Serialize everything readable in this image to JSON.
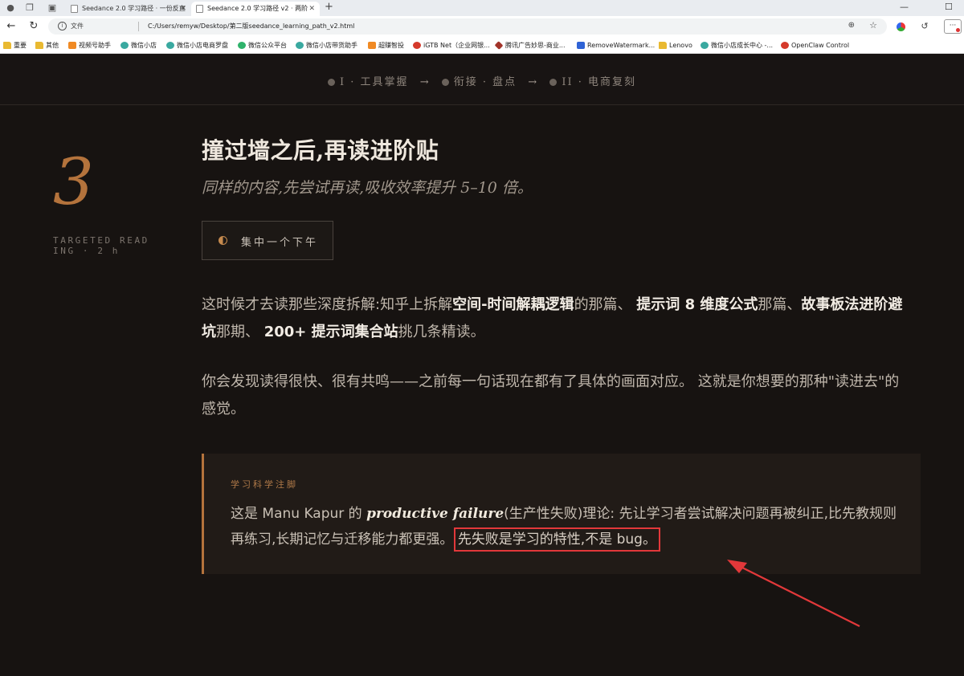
{
  "browser": {
    "tabs": [
      {
        "title": "Seedance 2.0 学习路径 · 一份反直"
      },
      {
        "title": "Seedance 2.0 学习路径 v2 · 两阶"
      }
    ],
    "address": {
      "file_label": "文件",
      "url": "C:/Users/remyw/Desktop/第二版seedance_learning_path_v2.html"
    },
    "bookmarks": [
      {
        "label": "重要",
        "icon": "folder-icon"
      },
      {
        "label": "其他",
        "icon": "folder-icon"
      },
      {
        "label": "视频号助手",
        "icon": "channels-icon"
      },
      {
        "label": "微信小店",
        "icon": "wechat-shop-icon"
      },
      {
        "label": "微信小店电商罗盘",
        "icon": "wechat-shop-icon"
      },
      {
        "label": "微信公众平台",
        "icon": "wechat-icon"
      },
      {
        "label": "微信小店带货助手",
        "icon": "wechat-shop-icon"
      },
      {
        "label": "超赚智投",
        "icon": "ad-icon"
      },
      {
        "label": "iGTB Net（企业网银...",
        "icon": "bank-icon"
      },
      {
        "label": "腾讯广告妙思-商业...",
        "icon": "tencent-ad-icon"
      },
      {
        "label": "RemoveWatermark...",
        "icon": "edit-icon"
      },
      {
        "label": "Lenovo",
        "icon": "folder-icon"
      },
      {
        "label": "微信小店成长中心 -...",
        "icon": "wechat-shop-icon"
      },
      {
        "label": "OpenClaw Control",
        "icon": "claw-icon"
      }
    ]
  },
  "progress": {
    "step1": "I · 工具掌握",
    "arrow1": "→",
    "step2": "衔接 · 盘点",
    "arrow2": "→",
    "step3": "II · 电商复刻"
  },
  "section": {
    "number": "3",
    "meta": "TARGETED READING · 2 h",
    "title": "撞过墙之后,再读进阶贴",
    "subtitle": "同样的内容,先尝试再读,吸收效率提升 5–10 倍。",
    "duration": "集中一个下午"
  },
  "para1": {
    "t1": "这时候才去读那些深度拆解:知乎上拆解",
    "b1": "空间-时间解耦逻辑",
    "t2": "的那篇、 ",
    "b2": "提示词 8 维度公式",
    "t3": "那篇、",
    "b3": "故事板法进阶避坑",
    "t4": "那期、 ",
    "b4": "200+ 提示词集合站",
    "t5": "挑几条精读。"
  },
  "para2": {
    "text": "你会发现读得很快、很有共鸣——之前每一句话现在都有了具体的画面对应。 这就是你想要的那种\"读进去\"的感觉。"
  },
  "note": {
    "label": "学习科学注脚",
    "t1": "这是 Manu Kapur 的 ",
    "em": "productive failure",
    "t2": "(生产性失败)理论: 先让学习者尝试解决问题再被纠正,比先教规则再练习,长期记忆与迁移能力都更强。 ",
    "highlight": "先失败是学习的特性,不是 bug。"
  },
  "colors": {
    "accent": "#b4733c",
    "background": "#171311",
    "annotation": "#e2383a"
  }
}
